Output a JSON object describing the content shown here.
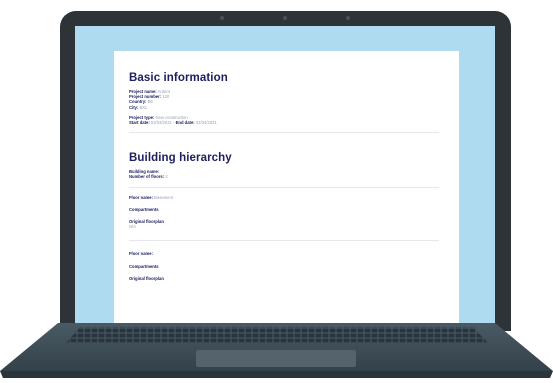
{
  "document": {
    "basic": {
      "heading": "Basic information",
      "project_name_label": "Project name:",
      "project_name_value": "Ardent",
      "project_number_label": "Project number:",
      "project_number_value": "120",
      "country_label": "Country:",
      "country_value": "BE",
      "city_label": "City:",
      "city_value": "BXL",
      "project_type_label": "Project type:",
      "project_type_value": "New construction",
      "start_date_label": "Start date:",
      "start_date_value": "02/03/2021",
      "end_date_label": "End date:",
      "end_date_value": "02/04/2021"
    },
    "hierarchy": {
      "heading": "Building hierarchy",
      "building_name_label": "Building name:",
      "floors_label": "Number of floors:",
      "floors_value": "2",
      "floors": [
        {
          "floor_name_label": "Floor name:",
          "floor_name_value": "Basement",
          "compartments_label": "Compartments",
          "floorplan_label": "Original floorplan",
          "floorplan_value": "N/A"
        },
        {
          "floor_name_label": "Floor name:",
          "floor_name_value": "",
          "compartments_label": "Compartments",
          "floorplan_label": "Original floorplan",
          "floorplan_value": ""
        }
      ]
    }
  },
  "colors": {
    "screen_background": "#aedbf0",
    "heading": "#1d2160",
    "value_text": "#9aa0b5",
    "laptop_body": "#2e3338",
    "keyboard_deck": "#3d4b55"
  }
}
